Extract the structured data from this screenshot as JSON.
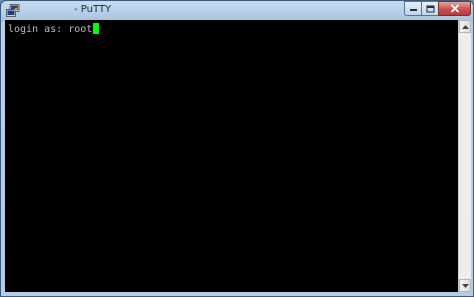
{
  "window": {
    "title": "- PuTTY",
    "app_icon": "putty-icon",
    "controls": {
      "minimize_icon": "minimize-icon",
      "maximize_icon": "maximize-icon",
      "close_icon": "close-icon"
    }
  },
  "terminal": {
    "background": "#000000",
    "text_color": "#bbbbbb",
    "cursor_color": "#00ff00",
    "lines": [
      {
        "text": "login as: root"
      }
    ]
  },
  "scrollbar": {
    "up_icon": "scroll-up-arrow-icon",
    "down_icon": "scroll-down-arrow-icon"
  }
}
